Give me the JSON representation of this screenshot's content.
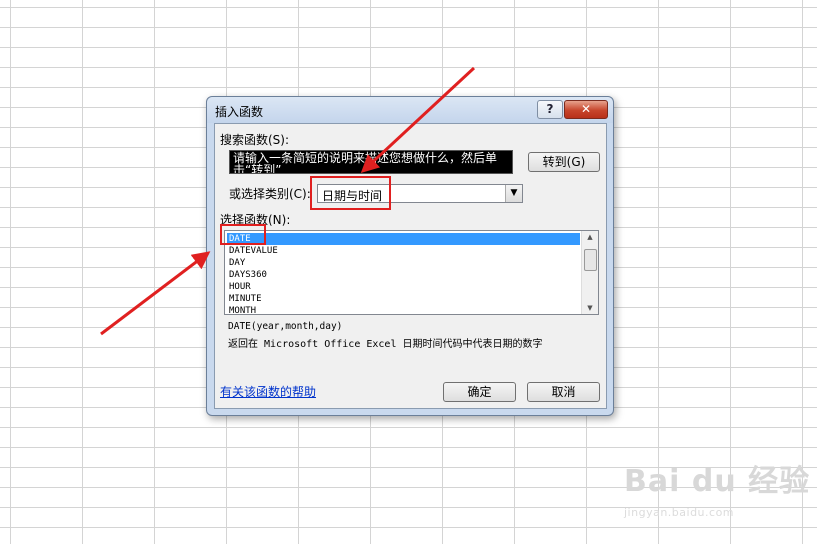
{
  "dialog": {
    "title": "插入函数",
    "help_button": "?",
    "close_button": "✕",
    "search_label": "搜索函数(S):",
    "search_value": "请输入一条简短的说明来描述您想做什么，然后单击“转到”",
    "goto_button": "转到(G)",
    "category_label": "或选择类别(C):",
    "category_value": "日期与时间",
    "function_list_label": "选择函数(N):",
    "functions": [
      "DATE",
      "DATEVALUE",
      "DAY",
      "DAYS360",
      "HOUR",
      "MINUTE",
      "MONTH"
    ],
    "selected_function": "DATE",
    "syntax": "DATE(year,month,day)",
    "description": "返回在 Microsoft Office Excel 日期时间代码中代表日期的数字",
    "help_link": "有关该函数的帮助",
    "ok_button": "确定",
    "cancel_button": "取消"
  },
  "annotation_color": "#e02020",
  "watermark": {
    "brand": "Bai du 经验",
    "url": "jingyan.baidu.com"
  }
}
